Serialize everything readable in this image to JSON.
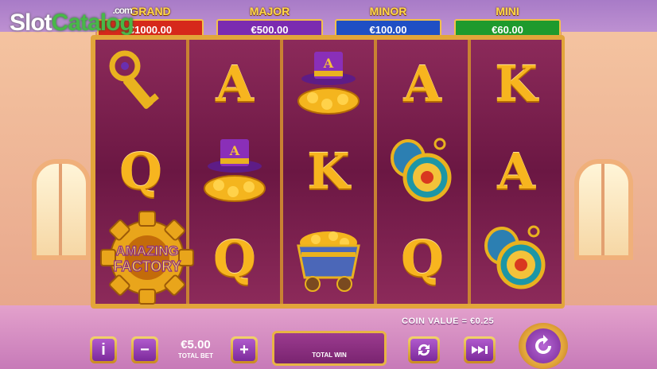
{
  "logo": {
    "part1": "Slot",
    "part2": "Catalog",
    "suffix": ".com"
  },
  "jackpots": [
    {
      "name": "GRAND",
      "value": "€1000.00",
      "color": "#d6281b"
    },
    {
      "name": "MAJOR",
      "value": "€500.00",
      "color": "#7b2bb0"
    },
    {
      "name": "MINOR",
      "value": "€100.00",
      "color": "#1f4fc4"
    },
    {
      "name": "MINI",
      "value": "€60.00",
      "color": "#1e9a2d"
    }
  ],
  "reels": [
    [
      "key-icon",
      "Q",
      "amazing-factory-scatter-icon"
    ],
    [
      "A",
      "top-hat-coins-icon",
      "Q"
    ],
    [
      "top-hat-coins-icon",
      "K",
      "mine-cart-gold-icon"
    ],
    [
      "A",
      "pocket-watch-icon",
      "Q"
    ],
    [
      "K",
      "A",
      "pocket-watch-icon"
    ]
  ],
  "scatter": {
    "line1": "AMAZING",
    "line2": "FACTORY"
  },
  "controls": {
    "info_label": "i",
    "minus_label": "−",
    "plus_label": "+",
    "bet_value": "€5.00",
    "bet_label": "TOTAL BET",
    "total_win_label": "TOTAL WIN",
    "coin_value_text": "COIN VALUE = €0.25"
  }
}
